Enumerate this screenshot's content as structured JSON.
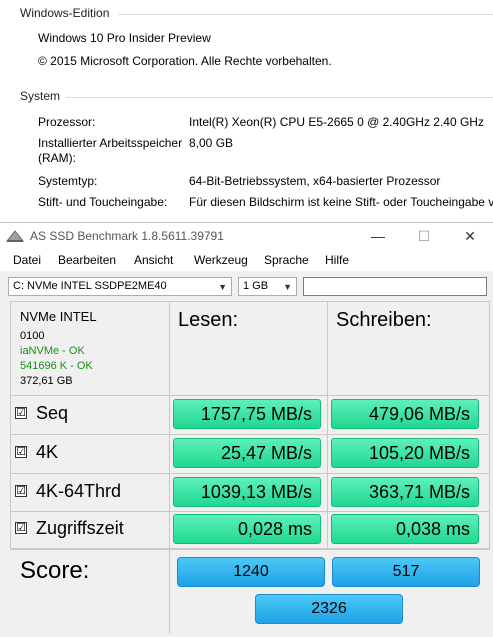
{
  "system_props": {
    "edition_header": "Windows-Edition",
    "edition_name": "Windows 10 Pro Insider Preview",
    "copyright": "© 2015 Microsoft Corporation. Alle Rechte vorbehalten.",
    "system_header": "System",
    "rows": [
      {
        "label": "Prozessor:",
        "value": "Intel(R) Xeon(R) CPU E5-2665 0 @ 2.40GHz   2.40 GHz"
      },
      {
        "label": "Installierter Arbeitsspeicher",
        "label2": "(RAM):",
        "value": "8,00 GB"
      },
      {
        "label": "Systemtyp:",
        "value": "64-Bit-Betriebssystem, x64-basierter Prozessor"
      },
      {
        "label": "Stift- und Toucheingabe:",
        "value": "Für diesen Bildschirm ist keine Stift- oder Toucheingabe ve"
      }
    ]
  },
  "window": {
    "title": "AS SSD Benchmark 1.8.5611.39791",
    "controls": {
      "minimize": "—",
      "maximize": "☐",
      "close": "✕"
    },
    "menu": [
      "Datei",
      "Bearbeiten",
      "Ansicht",
      "Werkzeug",
      "Sprache",
      "Hilfe"
    ],
    "drive_select": "C: NVMe INTEL SSDPE2ME40",
    "size_select": "1 GB",
    "size_input": ""
  },
  "drive_info": {
    "model": "NVMe INTEL",
    "firmware": "0100",
    "driver_status": "iaNVMe - OK",
    "alignment_status": "541696 K - OK",
    "capacity": "372,61 GB"
  },
  "headers": {
    "read": "Lesen:",
    "write": "Schreiben:"
  },
  "tests": [
    {
      "name": "Seq",
      "checked": "☑",
      "read": "1757,75 MB/s",
      "write": "479,06 MB/s"
    },
    {
      "name": "4K",
      "checked": "☑",
      "read": "25,47 MB/s",
      "write": "105,20 MB/s"
    },
    {
      "name": "4K-64Thrd",
      "checked": "☑",
      "read": "1039,13 MB/s",
      "write": "363,71 MB/s"
    },
    {
      "name": "Zugriffszeit",
      "checked": "☑",
      "read": "0,028 ms",
      "write": "0,038 ms"
    }
  ],
  "score": {
    "label": "Score:",
    "read": "1240",
    "write": "517",
    "total": "2326"
  },
  "colors": {
    "ok_green": "#1a8f1a",
    "result_green": "#2be09c",
    "score_blue": "#2fb0ee"
  }
}
